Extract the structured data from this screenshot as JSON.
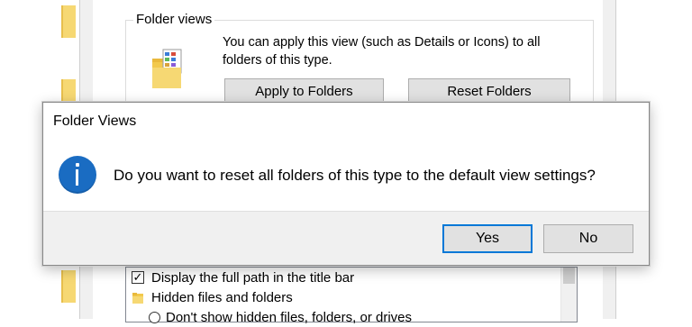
{
  "folder_options": {
    "group_title": "Folder views",
    "description": "You can apply this view (such as Details or Icons) to all folders of this type.",
    "apply_button": "Apply to Folders",
    "reset_button": "Reset Folders",
    "advanced_items": [
      {
        "label": "Display the full path in the title bar",
        "checked": true
      },
      {
        "label": "Hidden files and folders"
      },
      {
        "label": "Don't show hidden files, folders, or drives"
      }
    ]
  },
  "dialog": {
    "title": "Folder Views",
    "message": "Do you want to reset all folders of this type to the default view settings?",
    "yes_label": "Yes",
    "no_label": "No",
    "icon": "info-icon"
  },
  "colors": {
    "accent": "#0078d7",
    "info_icon": "#1a6cc2",
    "folder": "#f6d873"
  }
}
